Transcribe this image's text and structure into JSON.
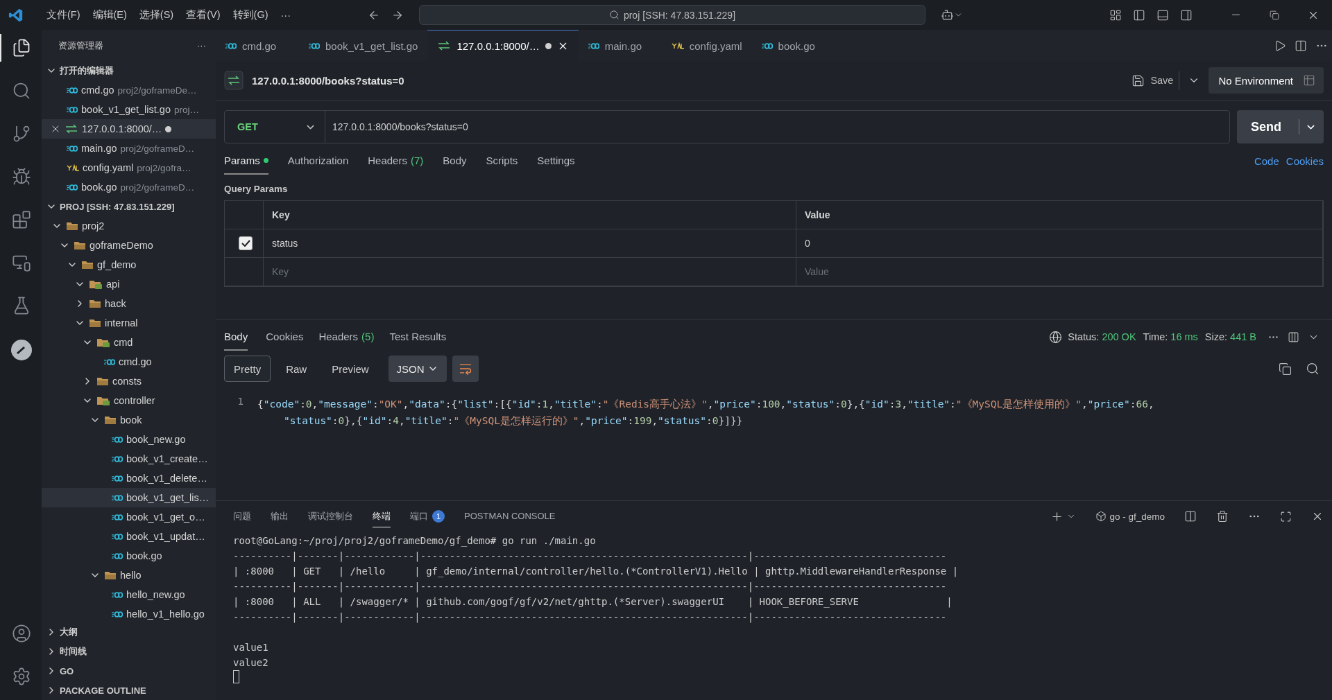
{
  "title_bar": {
    "menus": [
      "文件(F)",
      "编辑(E)",
      "选择(S)",
      "查看(V)",
      "转到(G)"
    ],
    "more": "···",
    "search": "proj [SSH: 47.83.151.229]"
  },
  "explorer": {
    "title": "资源管理器",
    "more": "···",
    "open_editors": {
      "title": "打开的编辑器",
      "expanded": true,
      "items": [
        {
          "name": "cmd.go",
          "path": "proj2/goframeDe…",
          "kind": "go",
          "selected": false,
          "modified": false
        },
        {
          "name": "book_v1_get_list.go",
          "path": "proj…",
          "kind": "go",
          "selected": false,
          "modified": false
        },
        {
          "name": "127.0.0.1:8000/…",
          "kind": "http",
          "selected": true,
          "modified": true
        },
        {
          "name": "main.go",
          "path": "proj2/goframeD…",
          "kind": "go",
          "selected": false,
          "modified": false
        },
        {
          "name": "config.yaml",
          "path": "proj2/gofra…",
          "kind": "yaml",
          "selected": false,
          "modified": false
        },
        {
          "name": "book.go",
          "path": "proj2/goframeD…",
          "kind": "go",
          "selected": false,
          "modified": false
        }
      ]
    },
    "project": {
      "title": "PROJ [SSH: 47.83.151.229]",
      "expanded": true,
      "tree": [
        {
          "name": "proj2",
          "kind": "folder",
          "expanded": true,
          "selected": false,
          "children": [
            {
              "name": "goframeDemo",
              "kind": "folder",
              "expanded": true,
              "selected": false,
              "children": [
                {
                  "name": "gf_demo",
                  "kind": "folder",
                  "expanded": true,
                  "selected": false,
                  "children": [
                    {
                      "name": "api",
                      "kind": "special-folder",
                      "expanded": true,
                      "selected": false
                    },
                    {
                      "name": "hack",
                      "kind": "folder",
                      "expanded": false,
                      "selected": false
                    },
                    {
                      "name": "internal",
                      "kind": "folder",
                      "expanded": true,
                      "selected": false,
                      "children": [
                        {
                          "name": "cmd",
                          "kind": "special-folder",
                          "expanded": true,
                          "selected": false,
                          "children": [
                            {
                              "name": "cmd.go",
                              "kind": "go",
                              "selected": false
                            }
                          ]
                        },
                        {
                          "name": "consts",
                          "kind": "folder",
                          "expanded": false,
                          "selected": false
                        },
                        {
                          "name": "controller",
                          "kind": "special-folder",
                          "expanded": true,
                          "selected": false,
                          "children": [
                            {
                              "name": "book",
                              "kind": "folder",
                              "expanded": true,
                              "selected": false,
                              "children": [
                                {
                                  "name": "book_new.go",
                                  "kind": "go",
                                  "selected": false
                                },
                                {
                                  "name": "book_v1_create…",
                                  "kind": "go",
                                  "selected": false
                                },
                                {
                                  "name": "book_v1_delete…",
                                  "kind": "go",
                                  "selected": false
                                },
                                {
                                  "name": "book_v1_get_lis…",
                                  "kind": "go",
                                  "selected": true
                                },
                                {
                                  "name": "book_v1_get_o…",
                                  "kind": "go",
                                  "selected": false
                                },
                                {
                                  "name": "book_v1_updat…",
                                  "kind": "go",
                                  "selected": false
                                },
                                {
                                  "name": "book.go",
                                  "kind": "go",
                                  "selected": false
                                }
                              ]
                            },
                            {
                              "name": "hello",
                              "kind": "folder",
                              "expanded": true,
                              "selected": false,
                              "children": [
                                {
                                  "name": "hello_new.go",
                                  "kind": "go",
                                  "selected": false
                                },
                                {
                                  "name": "hello_v1_hello.go",
                                  "kind": "go",
                                  "selected": false
                                }
                              ]
                            }
                          ]
                        }
                      ]
                    }
                  ]
                }
              ]
            }
          ]
        }
      ]
    },
    "sections": [
      {
        "title": "大纲",
        "expanded": false
      },
      {
        "title": "时间线",
        "expanded": false
      },
      {
        "title": "GO",
        "expanded": false
      },
      {
        "title": "PACKAGE OUTLINE",
        "expanded": false
      }
    ]
  },
  "editor_tabs": [
    {
      "label": "cmd.go",
      "kind": "go",
      "selected": false,
      "modified": false
    },
    {
      "label": "book_v1_get_list.go",
      "kind": "go",
      "selected": false,
      "modified": false
    },
    {
      "label": "127.0.0.1:8000/…",
      "kind": "http",
      "selected": true,
      "modified": true
    },
    {
      "label": "main.go",
      "kind": "go",
      "selected": false,
      "modified": false
    },
    {
      "label": "config.yaml",
      "kind": "yaml",
      "selected": false,
      "modified": false
    },
    {
      "label": "book.go",
      "kind": "go",
      "selected": false,
      "modified": false
    }
  ],
  "request": {
    "title": "127.0.0.1:8000/books?status=0",
    "save": "Save",
    "environment": "No Environment",
    "method": "GET",
    "url": "127.0.0.1:8000/books?status=0",
    "send": "Send",
    "tabs": [
      {
        "label": "Params",
        "selected": true,
        "indicator": true
      },
      {
        "label": "Authorization",
        "selected": false
      },
      {
        "label": "Headers",
        "count": "(7)",
        "selected": false
      },
      {
        "label": "Body",
        "selected": false
      },
      {
        "label": "Scripts",
        "selected": false
      },
      {
        "label": "Settings",
        "selected": false
      }
    ],
    "links": [
      "Code",
      "Cookies"
    ],
    "query_params": {
      "title": "Query Params",
      "columns": [
        "Key",
        "Value"
      ],
      "rows": [
        {
          "checked": true,
          "key": "status",
          "value": "0"
        }
      ],
      "key_placeholder": "Key",
      "value_placeholder": "Value"
    }
  },
  "response": {
    "tabs": [
      {
        "label": "Body",
        "selected": true
      },
      {
        "label": "Cookies",
        "selected": false
      },
      {
        "label": "Headers",
        "count": "(5)",
        "selected": false
      },
      {
        "label": "Test Results",
        "selected": false
      }
    ],
    "status_label": "Status:",
    "status": "200 OK",
    "time_label": "Time:",
    "time": "16 ms",
    "size_label": "Size:",
    "size": "441 B",
    "views": [
      {
        "label": "Pretty",
        "selected": true
      },
      {
        "label": "Raw",
        "selected": false
      },
      {
        "label": "Preview",
        "selected": false
      }
    ],
    "format": "JSON",
    "wrap": true,
    "line_number": "1",
    "body_lines": [
      "{\"code\":0,\"message\":\"OK\",\"data\":{\"list\":[{\"id\":1,\"title\":\"《Redis高手心法》\",\"price\":100,\"status\":0},{\"id\":3,\"title\":\"《MySQL是怎样使用的》\",\"price\":66,",
      "\"status\":0},{\"id\":4,\"title\":\"《MySQL是怎样运行的》\",\"price\":199,\"status\":0}]}}"
    ]
  },
  "panel": {
    "tabs": [
      {
        "label": "问题",
        "selected": false
      },
      {
        "label": "输出",
        "selected": false
      },
      {
        "label": "调试控制台",
        "selected": false
      },
      {
        "label": "终端",
        "selected": true
      },
      {
        "label": "端口",
        "badge": "1",
        "selected": false
      },
      {
        "label": "POSTMAN CONSOLE",
        "selected": false
      }
    ],
    "terminal_name": "go - gf_demo",
    "lines": [
      "root@GoLang:~/proj/proj2/goframeDemo/gf_demo# go run ./main.go",
      "----------|-------|------------|--------------------------------------------------------|---------------------------------",
      "| :8000   | GET   | /hello     | gf_demo/internal/controller/hello.(*ControllerV1).Hello | ghttp.MiddlewareHandlerResponse |",
      "----------|-------|------------|--------------------------------------------------------|---------------------------------",
      "| :8000   | ALL   | /swagger/* | github.com/gogf/gf/v2/net/ghttp.(*Server).swaggerUI    | HOOK_BEFORE_SERVE               |",
      "----------|-------|------------|--------------------------------------------------------|---------------------------------"
    ],
    "output": [
      "value1",
      "value2"
    ]
  }
}
